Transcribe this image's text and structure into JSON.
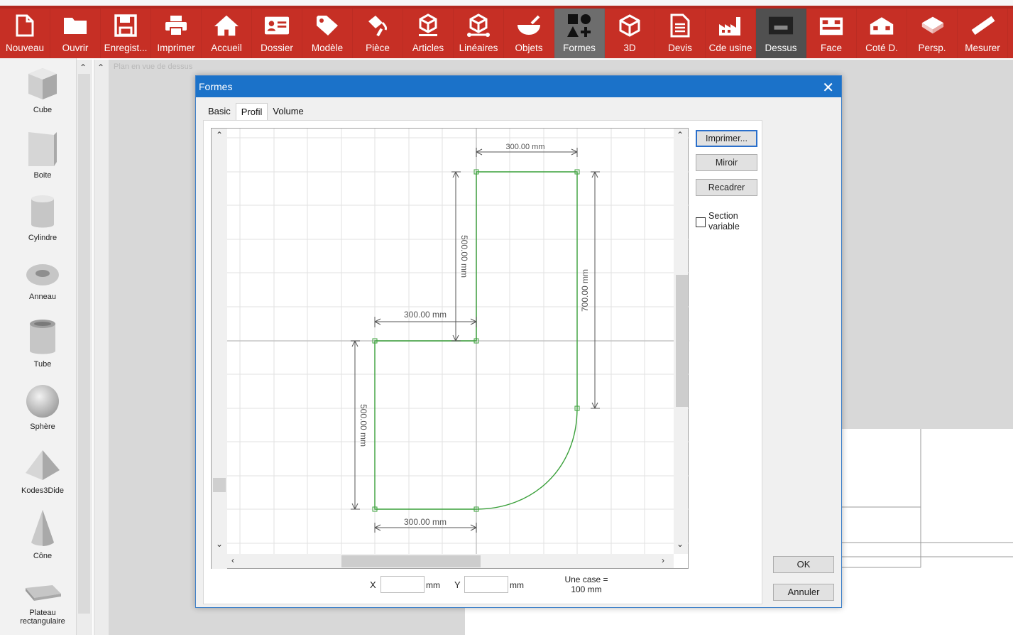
{
  "toolbar": {
    "items": [
      {
        "label": "Nouveau",
        "icon": "new-file-icon"
      },
      {
        "label": "Ouvrir",
        "icon": "folder-icon"
      },
      {
        "label": "Enregist...",
        "icon": "save-icon"
      },
      {
        "label": "Imprimer",
        "icon": "printer-icon"
      },
      {
        "label": "Accueil",
        "icon": "home-icon"
      },
      {
        "label": "Dossier",
        "icon": "id-card-icon"
      },
      {
        "label": "Modèle",
        "icon": "tag-icon"
      },
      {
        "label": "Pièce",
        "icon": "paint-icon"
      },
      {
        "label": "Articles",
        "icon": "cube-stand-icon"
      },
      {
        "label": "Linéaires",
        "icon": "cube-link-icon"
      },
      {
        "label": "Objets",
        "icon": "bowl-icon"
      },
      {
        "label": "Formes",
        "icon": "shapes-icon"
      },
      {
        "label": "3D",
        "icon": "cube-3d-icon"
      },
      {
        "label": "Devis",
        "icon": "document-icon"
      },
      {
        "label": "Cde usine",
        "icon": "factory-icon"
      },
      {
        "label": "Dessus",
        "icon": "top-view-icon"
      },
      {
        "label": "Face",
        "icon": "front-view-icon"
      },
      {
        "label": "Coté D.",
        "icon": "side-view-icon"
      },
      {
        "label": "Persp.",
        "icon": "perspective-icon"
      },
      {
        "label": "Mesurer",
        "icon": "ruler-icon"
      }
    ],
    "active_item": "Formes",
    "colors": {
      "bar": "#c62f25",
      "active": "#6d6d6d"
    }
  },
  "palette": {
    "items": [
      {
        "label": "Cube"
      },
      {
        "label": "Boite"
      },
      {
        "label": "Cylindre"
      },
      {
        "label": "Anneau"
      },
      {
        "label": "Tube"
      },
      {
        "label": "Sphère"
      },
      {
        "label": "Kodes3Dide"
      },
      {
        "label": "Cône"
      },
      {
        "label": "Plateau rectangulaire"
      }
    ]
  },
  "workspace": {
    "title": "Plan en vue de dessus"
  },
  "dialog": {
    "title": "Formes",
    "tabs": [
      "Basic",
      "Profil",
      "Volume"
    ],
    "active_tab": "Profil",
    "buttons": {
      "print": "Imprimer...",
      "mirror": "Miroir",
      "reframe": "Recadrer",
      "ok": "OK",
      "cancel": "Annuler"
    },
    "checkbox": {
      "label": "Section variable",
      "checked": false
    },
    "coords": {
      "x_label": "X",
      "y_label": "Y",
      "unit": "mm",
      "x_value": "",
      "y_value": ""
    },
    "grid_info": "Une case = 100 mm",
    "profile": {
      "dimensions": [
        "300.00 mm",
        "500.00 mm",
        "700.00 mm",
        "300.00 mm",
        "500.00 mm",
        "300.00 mm"
      ],
      "shape_color": "#3aa03a"
    }
  }
}
